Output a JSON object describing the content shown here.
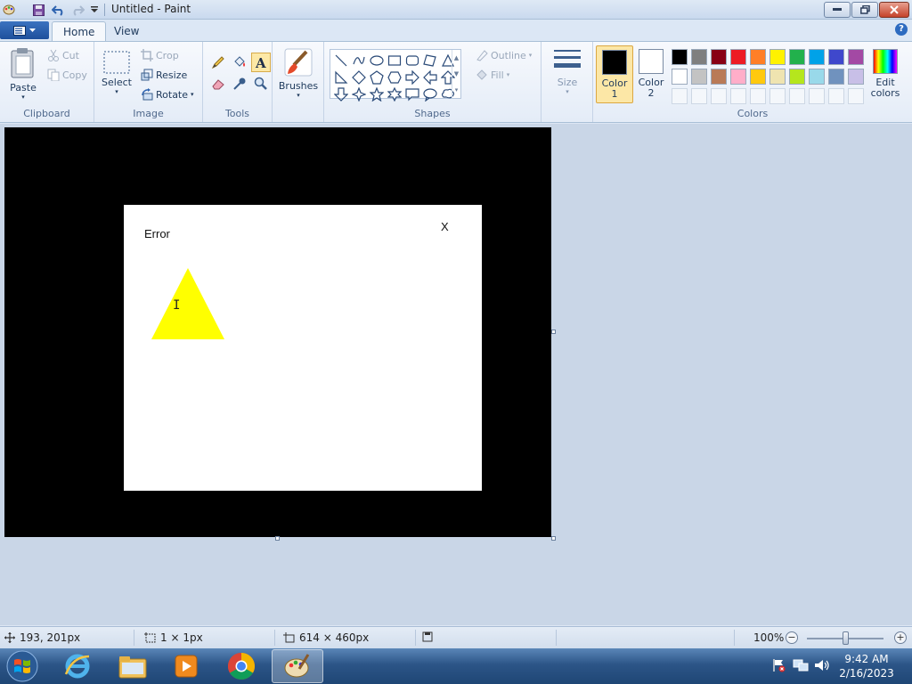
{
  "window": {
    "title": "Untitled - Paint",
    "minimize_icon": "minimize-icon",
    "maximize_icon": "restore-icon",
    "close_icon": "close-icon"
  },
  "quick_access": [
    "paint-app-icon",
    "save-icon",
    "undo-icon",
    "redo-icon",
    "customize-dropdown-icon"
  ],
  "tabs": [
    {
      "label": "Home",
      "active": true
    },
    {
      "label": "View",
      "active": false
    }
  ],
  "ribbon": {
    "clipboard": {
      "label": "Clipboard",
      "paste": "Paste",
      "cut": "Cut",
      "copy": "Copy"
    },
    "image": {
      "label": "Image",
      "select": "Select",
      "crop": "Crop",
      "resize": "Resize",
      "rotate": "Rotate"
    },
    "tools": {
      "label": "Tools",
      "items": [
        "pencil-icon",
        "fill-icon",
        "text-icon",
        "eraser-icon",
        "color-picker-icon",
        "magnifier-icon"
      ],
      "selected": "text-icon"
    },
    "brushes": {
      "label": "Brushes"
    },
    "shapes": {
      "label": "Shapes",
      "outline": "Outline",
      "fill": "Fill"
    },
    "size": {
      "label": "Size"
    },
    "colors": {
      "label": "Colors",
      "color1_label": "Color",
      "color1_num": "1",
      "color1_value": "#000000",
      "color2_label": "Color",
      "color2_num": "2",
      "color2_value": "#ffffff",
      "edit_label": "Edit",
      "edit_label2": "colors",
      "palette_row1": [
        "#000000",
        "#7f7f7f",
        "#880015",
        "#ed1c24",
        "#ff7f27",
        "#fff200",
        "#22b14c",
        "#00a2e8",
        "#3f48cc",
        "#a349a4"
      ],
      "palette_row2": [
        "#ffffff",
        "#c3c3c3",
        "#b97a57",
        "#ffaec9",
        "#ffc90e",
        "#efe4b0",
        "#b5e61d",
        "#99d9ea",
        "#7092be",
        "#c8bfe7"
      ],
      "palette_row3": [
        "",
        "",
        "",
        "",
        "",
        "",
        "",
        "",
        "",
        ""
      ]
    }
  },
  "canvas": {
    "background": "#000000",
    "dialog": {
      "title": "Error",
      "close": "X",
      "warning_color": "#ffff00"
    }
  },
  "status": {
    "cursor_pos": "193, 201px",
    "selection_size": "1 × 1px",
    "image_size": "614 × 460px",
    "zoom": "100%"
  },
  "taskbar": {
    "apps": [
      "internet-explorer-icon",
      "file-explorer-icon",
      "media-player-icon",
      "chrome-icon",
      "paint-icon"
    ],
    "active_app": "paint-icon",
    "time": "9:42 AM",
    "date": "2/16/2023"
  }
}
